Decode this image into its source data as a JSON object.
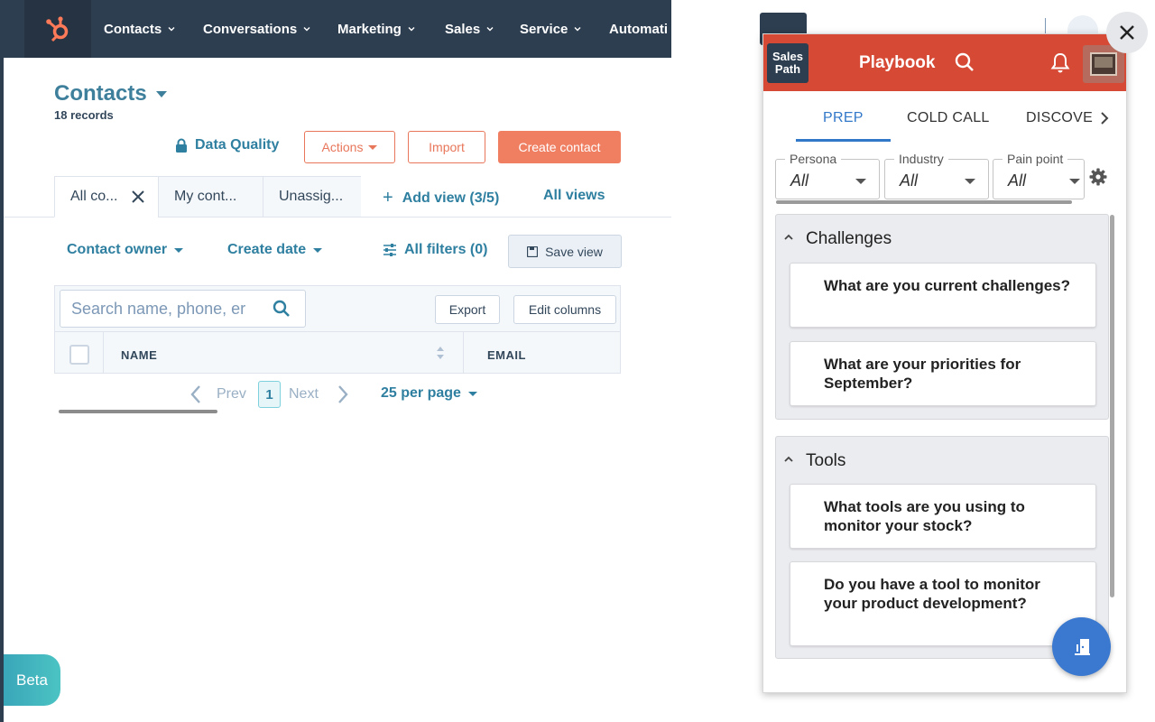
{
  "topnav": {
    "items": [
      "Contacts",
      "Conversations",
      "Marketing",
      "Sales",
      "Service",
      "Automati"
    ]
  },
  "page": {
    "title": "Contacts",
    "records": "18 records",
    "data_quality": "Data Quality",
    "actions_label": "Actions",
    "import_label": "Import",
    "create_label": "Create contact"
  },
  "views": {
    "tabs": [
      "All co...",
      "My cont...",
      "Unassig..."
    ],
    "add_view": "Add view (3/5)",
    "all_views": "All views"
  },
  "filters": {
    "contact_owner": "Contact owner",
    "create_date": "Create date",
    "all_filters": "All filters (0)",
    "save_view": "Save view"
  },
  "table": {
    "search_placeholder": "Search name, phone, er",
    "export_label": "Export",
    "edit_columns_label": "Edit columns",
    "columns": [
      "NAME",
      "EMAIL"
    ]
  },
  "pagination": {
    "prev": "Prev",
    "page": "1",
    "next": "Next",
    "per_page": "25 per page"
  },
  "beta_label": "Beta",
  "playbook": {
    "logo_text": "Sales Path",
    "title": "Playbook",
    "tabs": [
      "PREP",
      "COLD CALL",
      "DISCOVE"
    ],
    "active_tab": "PREP",
    "filters": [
      {
        "label": "Persona",
        "value": "All"
      },
      {
        "label": "Industry",
        "value": "All"
      },
      {
        "label": "Pain point",
        "value": "All"
      }
    ],
    "sections": [
      {
        "title": "Challenges",
        "questions": [
          "What are you current challenges?",
          "What are your priorities for September?"
        ]
      },
      {
        "title": "Tools",
        "questions": [
          "What tools are you using to monitor your stock?",
          "Do you have a tool to monitor your product development?"
        ]
      }
    ]
  },
  "colors": {
    "hubspot_nav": "#2d3e50",
    "hubspot_accent": "#f07f62",
    "link": "#2e7fa0",
    "playbook_header": "#d64a35",
    "playbook_tab_active": "#3278c9",
    "fab": "#3a79cf"
  },
  "icons": {
    "hubspot_logo": "hubspot-sprocket-icon",
    "lock": "lock-icon",
    "close_tab": "close-icon",
    "plus": "plus-icon",
    "sliders": "sliders-icon",
    "save": "floppy-icon",
    "search": "search-icon",
    "bell": "bell-icon",
    "gear": "gear-icon",
    "door": "door-exit-icon",
    "close_panel": "close-icon"
  }
}
